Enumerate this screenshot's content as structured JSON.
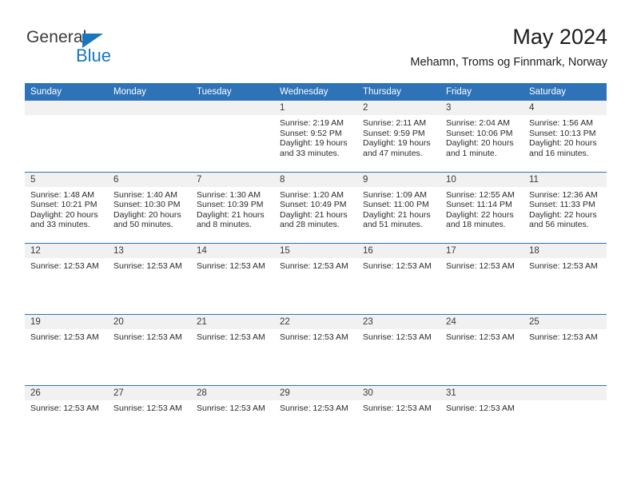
{
  "brand": {
    "name_part1": "General",
    "name_part2": "Blue",
    "triangle_icon": "triangle-icon",
    "colors": {
      "blue": "#1876bc",
      "gray": "#3b3b3b"
    }
  },
  "header": {
    "month_title": "May 2024",
    "location": "Mehamn, Troms og Finnmark, Norway"
  },
  "theme": {
    "header_blue": "#2e73b8",
    "daynum_band": "#f1f1f1",
    "text": "#2a2a2a"
  },
  "calendar": {
    "weekday_headers": [
      "Sunday",
      "Monday",
      "Tuesday",
      "Wednesday",
      "Thursday",
      "Friday",
      "Saturday"
    ],
    "weeks": [
      [
        {
          "day": "",
          "lines": []
        },
        {
          "day": "",
          "lines": []
        },
        {
          "day": "",
          "lines": []
        },
        {
          "day": "1",
          "lines": [
            "Sunrise: 2:19 AM",
            "Sunset: 9:52 PM",
            "Daylight: 19 hours and 33 minutes."
          ]
        },
        {
          "day": "2",
          "lines": [
            "Sunrise: 2:11 AM",
            "Sunset: 9:59 PM",
            "Daylight: 19 hours and 47 minutes."
          ]
        },
        {
          "day": "3",
          "lines": [
            "Sunrise: 2:04 AM",
            "Sunset: 10:06 PM",
            "Daylight: 20 hours and 1 minute."
          ]
        },
        {
          "day": "4",
          "lines": [
            "Sunrise: 1:56 AM",
            "Sunset: 10:13 PM",
            "Daylight: 20 hours and 16 minutes."
          ]
        }
      ],
      [
        {
          "day": "5",
          "lines": [
            "Sunrise: 1:48 AM",
            "Sunset: 10:21 PM",
            "Daylight: 20 hours and 33 minutes."
          ]
        },
        {
          "day": "6",
          "lines": [
            "Sunrise: 1:40 AM",
            "Sunset: 10:30 PM",
            "Daylight: 20 hours and 50 minutes."
          ]
        },
        {
          "day": "7",
          "lines": [
            "Sunrise: 1:30 AM",
            "Sunset: 10:39 PM",
            "Daylight: 21 hours and 8 minutes."
          ]
        },
        {
          "day": "8",
          "lines": [
            "Sunrise: 1:20 AM",
            "Sunset: 10:49 PM",
            "Daylight: 21 hours and 28 minutes."
          ]
        },
        {
          "day": "9",
          "lines": [
            "Sunrise: 1:09 AM",
            "Sunset: 11:00 PM",
            "Daylight: 21 hours and 51 minutes."
          ]
        },
        {
          "day": "10",
          "lines": [
            "Sunrise: 12:55 AM",
            "Sunset: 11:14 PM",
            "Daylight: 22 hours and 18 minutes."
          ]
        },
        {
          "day": "11",
          "lines": [
            "Sunrise: 12:36 AM",
            "Sunset: 11:33 PM",
            "Daylight: 22 hours and 56 minutes."
          ]
        }
      ],
      [
        {
          "day": "12",
          "lines": [
            "Sunrise: 12:53 AM"
          ]
        },
        {
          "day": "13",
          "lines": [
            "Sunrise: 12:53 AM"
          ]
        },
        {
          "day": "14",
          "lines": [
            "Sunrise: 12:53 AM"
          ]
        },
        {
          "day": "15",
          "lines": [
            "Sunrise: 12:53 AM"
          ]
        },
        {
          "day": "16",
          "lines": [
            "Sunrise: 12:53 AM"
          ]
        },
        {
          "day": "17",
          "lines": [
            "Sunrise: 12:53 AM"
          ]
        },
        {
          "day": "18",
          "lines": [
            "Sunrise: 12:53 AM"
          ]
        }
      ],
      [
        {
          "day": "19",
          "lines": [
            "Sunrise: 12:53 AM"
          ]
        },
        {
          "day": "20",
          "lines": [
            "Sunrise: 12:53 AM"
          ]
        },
        {
          "day": "21",
          "lines": [
            "Sunrise: 12:53 AM"
          ]
        },
        {
          "day": "22",
          "lines": [
            "Sunrise: 12:53 AM"
          ]
        },
        {
          "day": "23",
          "lines": [
            "Sunrise: 12:53 AM"
          ]
        },
        {
          "day": "24",
          "lines": [
            "Sunrise: 12:53 AM"
          ]
        },
        {
          "day": "25",
          "lines": [
            "Sunrise: 12:53 AM"
          ]
        }
      ],
      [
        {
          "day": "26",
          "lines": [
            "Sunrise: 12:53 AM"
          ]
        },
        {
          "day": "27",
          "lines": [
            "Sunrise: 12:53 AM"
          ]
        },
        {
          "day": "28",
          "lines": [
            "Sunrise: 12:53 AM"
          ]
        },
        {
          "day": "29",
          "lines": [
            "Sunrise: 12:53 AM"
          ]
        },
        {
          "day": "30",
          "lines": [
            "Sunrise: 12:53 AM"
          ]
        },
        {
          "day": "31",
          "lines": [
            "Sunrise: 12:53 AM"
          ]
        },
        {
          "day": "",
          "lines": []
        }
      ]
    ]
  }
}
